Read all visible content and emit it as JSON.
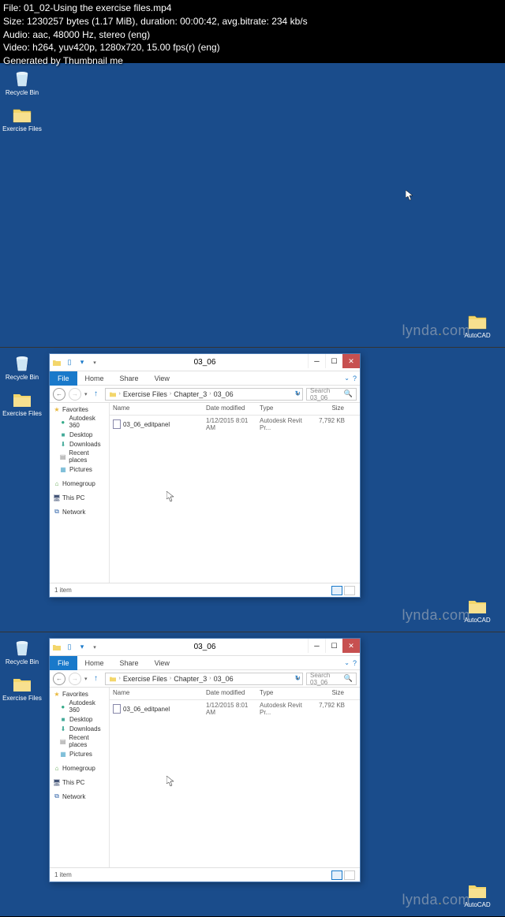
{
  "info": {
    "file": "File: 01_02-Using the exercise files.mp4",
    "size": "Size: 1230257 bytes (1.17 MiB), duration: 00:00:42, avg.bitrate: 234 kb/s",
    "audio": "Audio: aac, 48000 Hz, stereo (eng)",
    "video": "Video: h264, yuv420p, 1280x720, 15.00 fps(r) (eng)",
    "generated": "Generated by Thumbnail me"
  },
  "desktop_icons": {
    "recycle_bin": "Recycle Bin",
    "exercise_files": "Exercise Files",
    "autocad": "AutoCAD"
  },
  "watermark": {
    "text1": "lynda",
    "dot": ".",
    "text2": "com"
  },
  "explorer": {
    "title": "03_06",
    "ribbon": {
      "file": "File",
      "home": "Home",
      "share": "Share",
      "view": "View"
    },
    "breadcrumb": {
      "folder_icon": "📁",
      "parts": [
        "Exercise Files",
        "Chapter_3",
        "03_06"
      ]
    },
    "search_placeholder": "Search 03_06",
    "sidebar": {
      "favorites": "Favorites",
      "fav_items": [
        "Autodesk 360",
        "Desktop",
        "Downloads",
        "Recent places",
        "Pictures"
      ],
      "homegroup": "Homegroup",
      "this_pc": "This PC",
      "network": "Network"
    },
    "columns": {
      "name": "Name",
      "date": "Date modified",
      "type": "Type",
      "size": "Size"
    },
    "files": [
      {
        "name": "03_06_editpanel",
        "date": "1/12/2015 8:01 AM",
        "type": "Autodesk Revit Pr...",
        "size": "7,792 KB"
      }
    ],
    "status": "1 item"
  }
}
